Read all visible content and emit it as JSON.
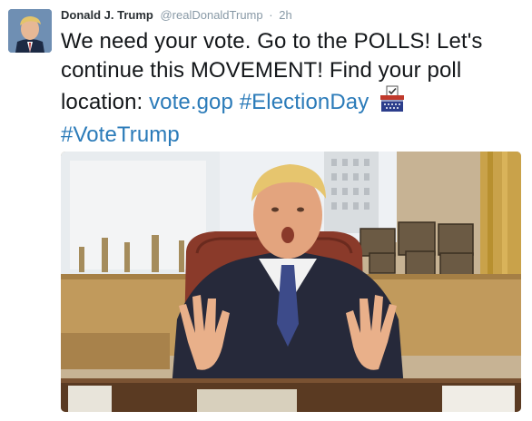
{
  "tweet": {
    "author_name": "Donald J. Trump",
    "handle": "@realDonaldTrump",
    "separator": "·",
    "time": "2h",
    "text_main": "We need your vote. Go to the POLLS! Let's continue this MOVEMENT! Find your poll location: ",
    "link_url": "vote.gop",
    "hashtag_1": "#ElectionDay",
    "hashtag_2": "#VoteTrump",
    "ballot_icon": "ballot-box-icon"
  },
  "colors": {
    "link": "#2b7bb9",
    "name": "#292f33",
    "meta": "#8899a6",
    "text": "#14171a"
  }
}
